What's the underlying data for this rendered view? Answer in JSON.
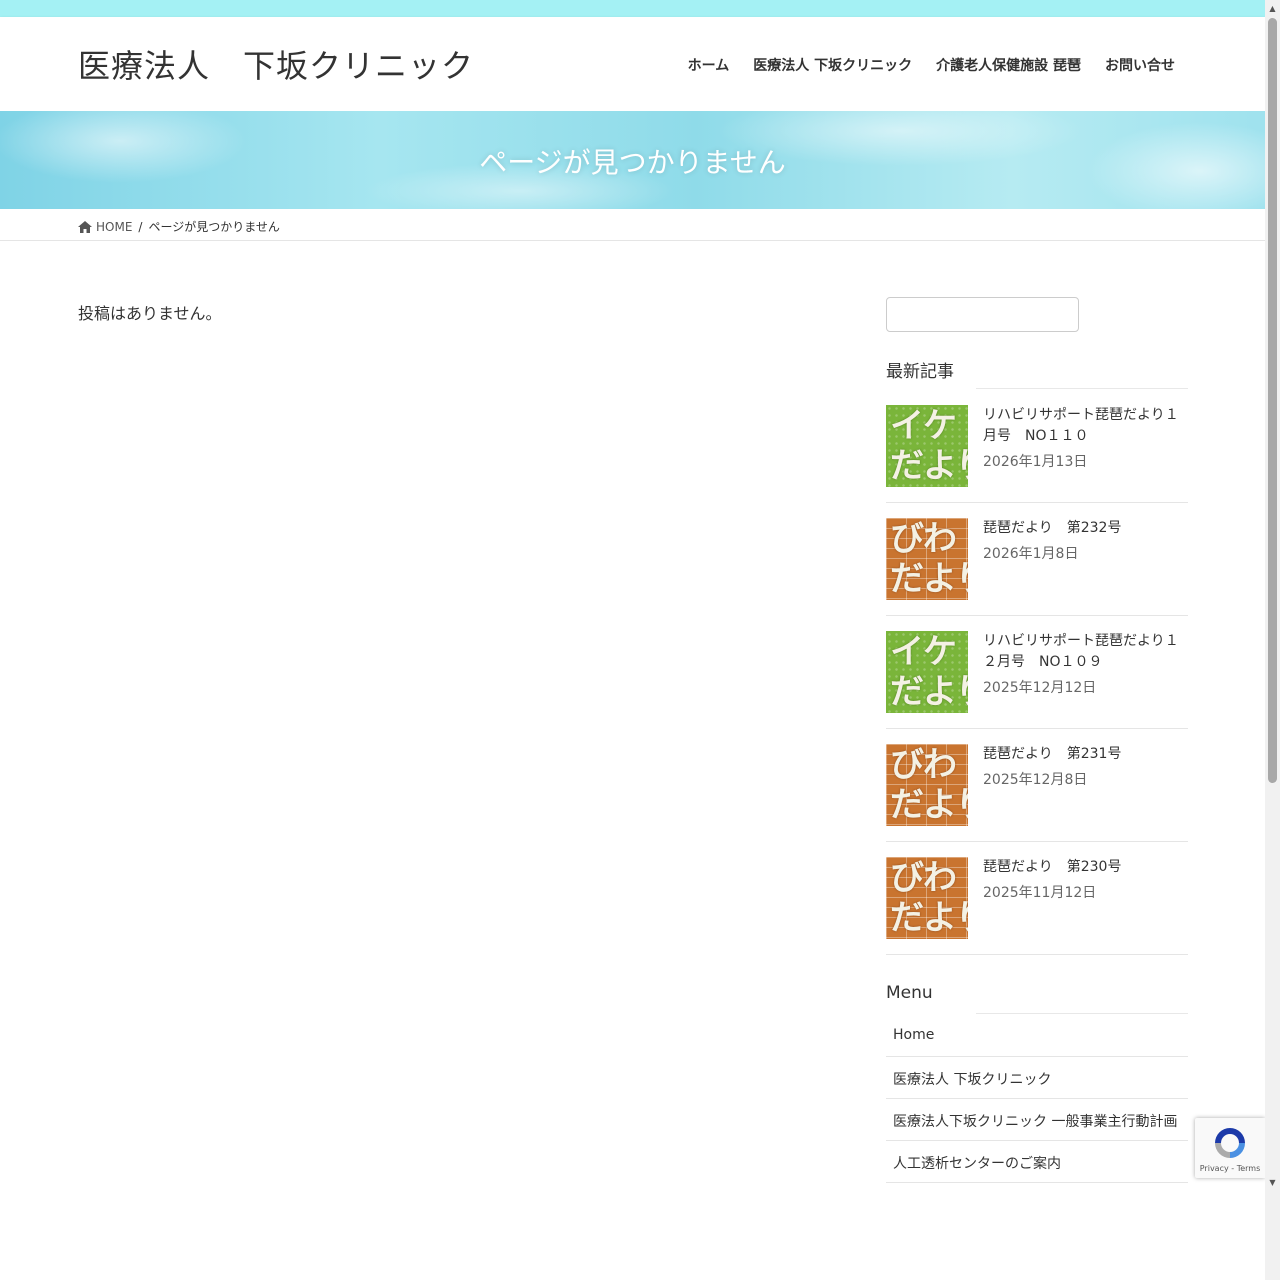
{
  "site": {
    "title": "医療法人　下坂クリニック"
  },
  "nav": [
    {
      "label": "ホーム"
    },
    {
      "label": "医療法人 下坂クリニック"
    },
    {
      "label": "介護老人保健施設 琵琶"
    },
    {
      "label": "お問い合せ"
    }
  ],
  "hero": {
    "title": "ページが見つかりません"
  },
  "breadcrumb": {
    "home": "HOME",
    "separator": "/",
    "current": "ページが見つかりません"
  },
  "main": {
    "message": "投稿はありません。"
  },
  "search": {
    "value": ""
  },
  "recent": {
    "title": "最新記事",
    "posts": [
      {
        "title": "リハビリサポート琵琶だより１月号　NO１１０",
        "date": "2026年1月13日",
        "thumb_text": [
          "イケ",
          "だより"
        ]
      },
      {
        "title": "琵琶だより　第232号",
        "date": "2026年1月8日",
        "thumb_text": [
          "びわ",
          "だより"
        ]
      },
      {
        "title": "リハビリサポート琵琶だより１２月号　NO１０９",
        "date": "2025年12月12日",
        "thumb_text": [
          "イケ",
          "だより"
        ]
      },
      {
        "title": "琵琶だより　第231号",
        "date": "2025年12月8日",
        "thumb_text": [
          "びわ",
          "だより"
        ]
      },
      {
        "title": "琵琶だより　第230号",
        "date": "2025年11月12日",
        "thumb_text": [
          "びわ",
          "だより"
        ]
      }
    ]
  },
  "menu": {
    "title": "Menu",
    "items": [
      {
        "label": "Home"
      },
      {
        "label": "医療法人 下坂クリニック"
      },
      {
        "label": "医療法人下坂クリニック 一般事業主行動計画"
      },
      {
        "label": "人工透析センターのご案内"
      }
    ]
  },
  "recaptcha": {
    "text": "Privacy - Terms"
  },
  "colors": {
    "topbar": "#a4f1f4",
    "hero": "#8fdbe9",
    "thumb_green": "#7ab53a",
    "thumb_brick": "#c9742f"
  }
}
